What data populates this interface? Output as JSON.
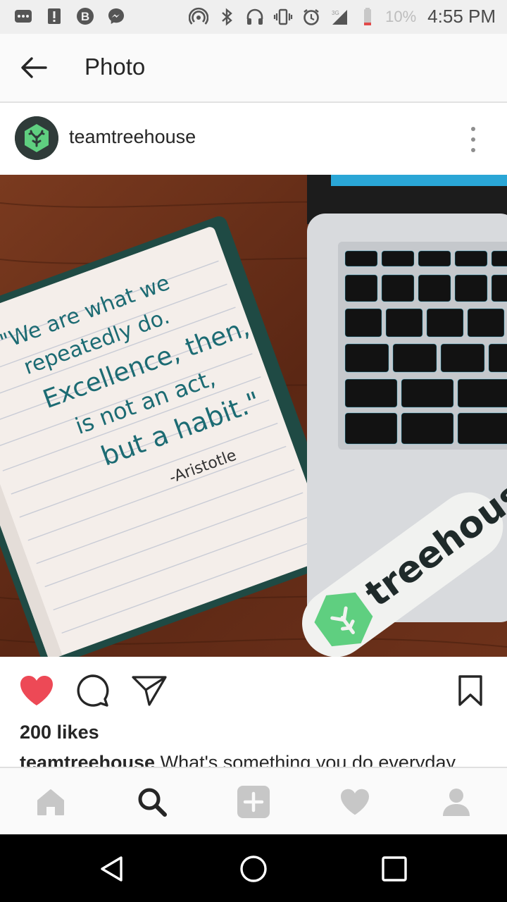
{
  "status_bar": {
    "battery_percent": "10%",
    "time": "4:55 PM",
    "icons": [
      "message-icon",
      "alert-icon",
      "b-icon",
      "messenger-icon",
      "hotspot-icon",
      "bluetooth-icon",
      "headset-icon",
      "vibrate-icon",
      "alarm-icon",
      "signal-icon",
      "battery-icon"
    ]
  },
  "app_bar": {
    "title": "Photo",
    "back_icon": "arrow-back-icon"
  },
  "post": {
    "username": "teamtreehouse",
    "photo": {
      "quote_lines": [
        "\"We are what we",
        "repeatedly do.",
        "Excellence, then,",
        "is not an act,",
        "but a habit.\""
      ],
      "author": "-Aristotle",
      "sticker_text": "treehouse"
    },
    "likes": "200 likes",
    "caption_user": "teamtreehouse",
    "caption_text": "What's something you do everyday"
  },
  "actions": {
    "liked": true,
    "like_color": "#ed4956"
  },
  "bottom_nav": {
    "items": [
      "home-icon",
      "search-icon",
      "add-icon",
      "heart-icon",
      "profile-icon"
    ],
    "active": "search-icon"
  },
  "colors": {
    "treehouse_green": "#5fcf80",
    "wood": "#6b2f1a"
  }
}
